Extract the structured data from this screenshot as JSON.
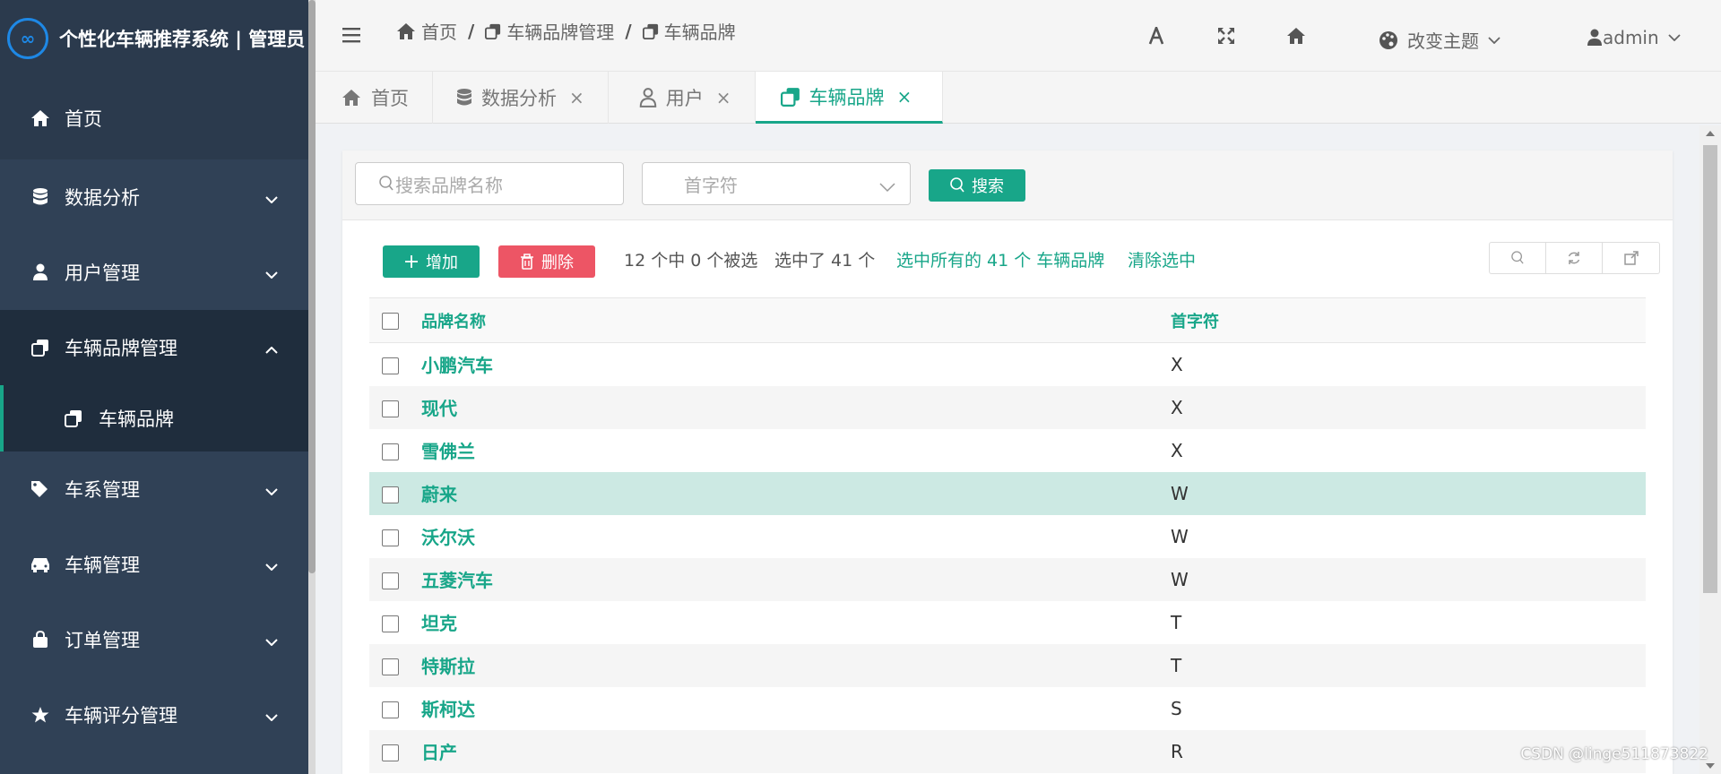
{
  "app": {
    "logo_text": "∞",
    "title": "个性化车辆推荐系统 | 管理员"
  },
  "sidebar": {
    "items": [
      {
        "label": "首页"
      },
      {
        "label": "数据分析"
      },
      {
        "label": "用户管理"
      },
      {
        "label": "车辆品牌管理"
      },
      {
        "label": "车辆品牌"
      },
      {
        "label": "车系管理"
      },
      {
        "label": "车辆管理"
      },
      {
        "label": "订单管理"
      },
      {
        "label": "车辆评分管理"
      }
    ]
  },
  "header": {
    "breadcrumb": [
      "首页",
      "车辆品牌管理",
      "车辆品牌"
    ],
    "separator": "/",
    "theme_label": "改变主题",
    "user_label": "admin"
  },
  "tabs": [
    {
      "label": "首页"
    },
    {
      "label": "数据分析"
    },
    {
      "label": "用户"
    },
    {
      "label": "车辆品牌"
    }
  ],
  "tab_close": "×",
  "search": {
    "placeholder": "搜索品牌名称",
    "select_placeholder": "首字符",
    "button": "搜索"
  },
  "actions": {
    "add": "增加",
    "delete": "删除",
    "count_info": "12 个中 0 个被选",
    "selected_info": "选中了 41 个",
    "select_all": "选中所有的 41 个 车辆品牌",
    "clear": "清除选中"
  },
  "table": {
    "columns": [
      "品牌名称",
      "首字符"
    ],
    "rows": [
      {
        "name": "小鹏汽车",
        "initial": "X"
      },
      {
        "name": "现代",
        "initial": "X"
      },
      {
        "name": "雪佛兰",
        "initial": "X"
      },
      {
        "name": "蔚来",
        "initial": "W"
      },
      {
        "name": "沃尔沃",
        "initial": "W"
      },
      {
        "name": "五菱汽车",
        "initial": "W"
      },
      {
        "name": "坦克",
        "initial": "T"
      },
      {
        "name": "特斯拉",
        "initial": "T"
      },
      {
        "name": "斯柯达",
        "initial": "S"
      },
      {
        "name": "日产",
        "initial": "R"
      }
    ]
  },
  "watermark": "CSDN @linge511873822",
  "colors": {
    "sidebar": "#304156",
    "accent": "#18a689",
    "danger": "#ed5565"
  }
}
